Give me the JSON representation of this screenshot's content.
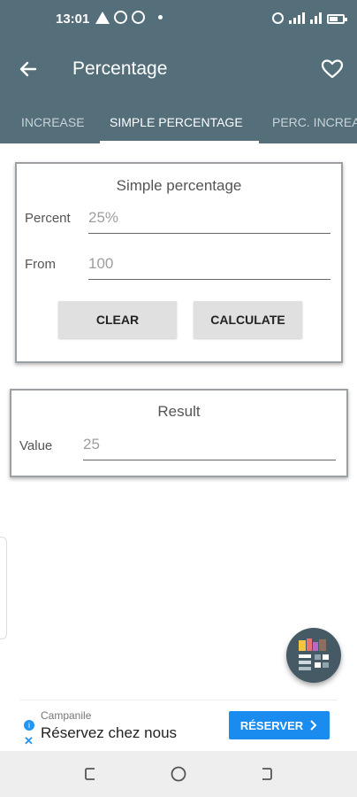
{
  "status_bar": {
    "time": "13:01",
    "icons": [
      "warning-icon",
      "b-circle-icon",
      "whatsapp-icon",
      "dot-icon"
    ],
    "right_icons": [
      "location-icon",
      "signal-icon",
      "lte-signal-icon",
      "battery-icon"
    ]
  },
  "app_bar": {
    "title": "Percentage",
    "back_icon": "arrow-back-icon",
    "favorite_icon": "heart-outline-icon"
  },
  "tabs": [
    {
      "label": "INCREASE",
      "active": false
    },
    {
      "label": "SIMPLE PERCENTAGE",
      "active": true
    },
    {
      "label": "PERC. INCREA",
      "active": false
    }
  ],
  "calc_card": {
    "title": "Simple percentage",
    "percent_label": "Percent",
    "percent_value": "25%",
    "from_label": "From",
    "from_value": "100",
    "clear_label": "CLEAR",
    "calculate_label": "CALCULATE"
  },
  "result_card": {
    "title": "Result",
    "value_label": "Value",
    "value": "25"
  },
  "ad": {
    "sponsor": "Campanile",
    "text": "Réservez chez nous",
    "cta": "RÉSERVER"
  },
  "colors": {
    "app_bar": "#546e7a",
    "button": "#e0e0e0",
    "ad_cta": "#1a8cf0"
  }
}
